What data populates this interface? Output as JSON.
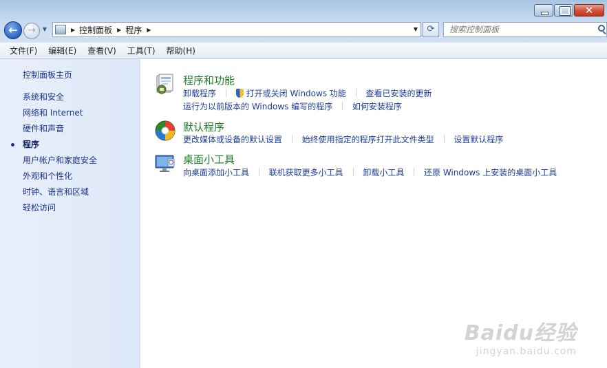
{
  "window": {
    "close_glyph": "✕"
  },
  "nav": {
    "back_glyph": "←",
    "forward_glyph": "→",
    "breadcrumb": [
      "控制面板",
      "程序"
    ],
    "search_placeholder": "搜索控制面板",
    "refresh_glyph": "⟳"
  },
  "menu": [
    "文件(F)",
    "编辑(E)",
    "查看(V)",
    "工具(T)",
    "帮助(H)"
  ],
  "left_pane": {
    "home": "控制面板主页",
    "items": [
      "系统和安全",
      "网络和 Internet",
      "硬件和声音",
      "程序",
      "用户帐户和家庭安全",
      "外观和个性化",
      "时钟、语言和区域",
      "轻松访问"
    ],
    "active_item": "程序"
  },
  "categories": [
    {
      "title": "程序和功能",
      "icon": "programs-features-icon",
      "links_row1": [
        "卸载程序",
        "打开或关闭 Windows 功能",
        "查看已安装的更新"
      ],
      "links_row2": [
        "运行为以前版本的 Windows 编写的程序",
        "如何安装程序"
      ]
    },
    {
      "title": "默认程序",
      "icon": "default-programs-icon",
      "links_row1": [
        "更改媒体或设备的默认设置",
        "始终使用指定的程序打开此文件类型",
        "设置默认程序"
      ]
    },
    {
      "title": "桌面小工具",
      "icon": "desktop-gadgets-icon",
      "links_row1": [
        "向桌面添加小工具",
        "联机获取更多小工具",
        "卸载小工具",
        "还原 Windows 上安装的桌面小工具"
      ]
    }
  ],
  "watermark": {
    "brand": "Baidu经验",
    "url": "jingyan.baidu.com"
  }
}
